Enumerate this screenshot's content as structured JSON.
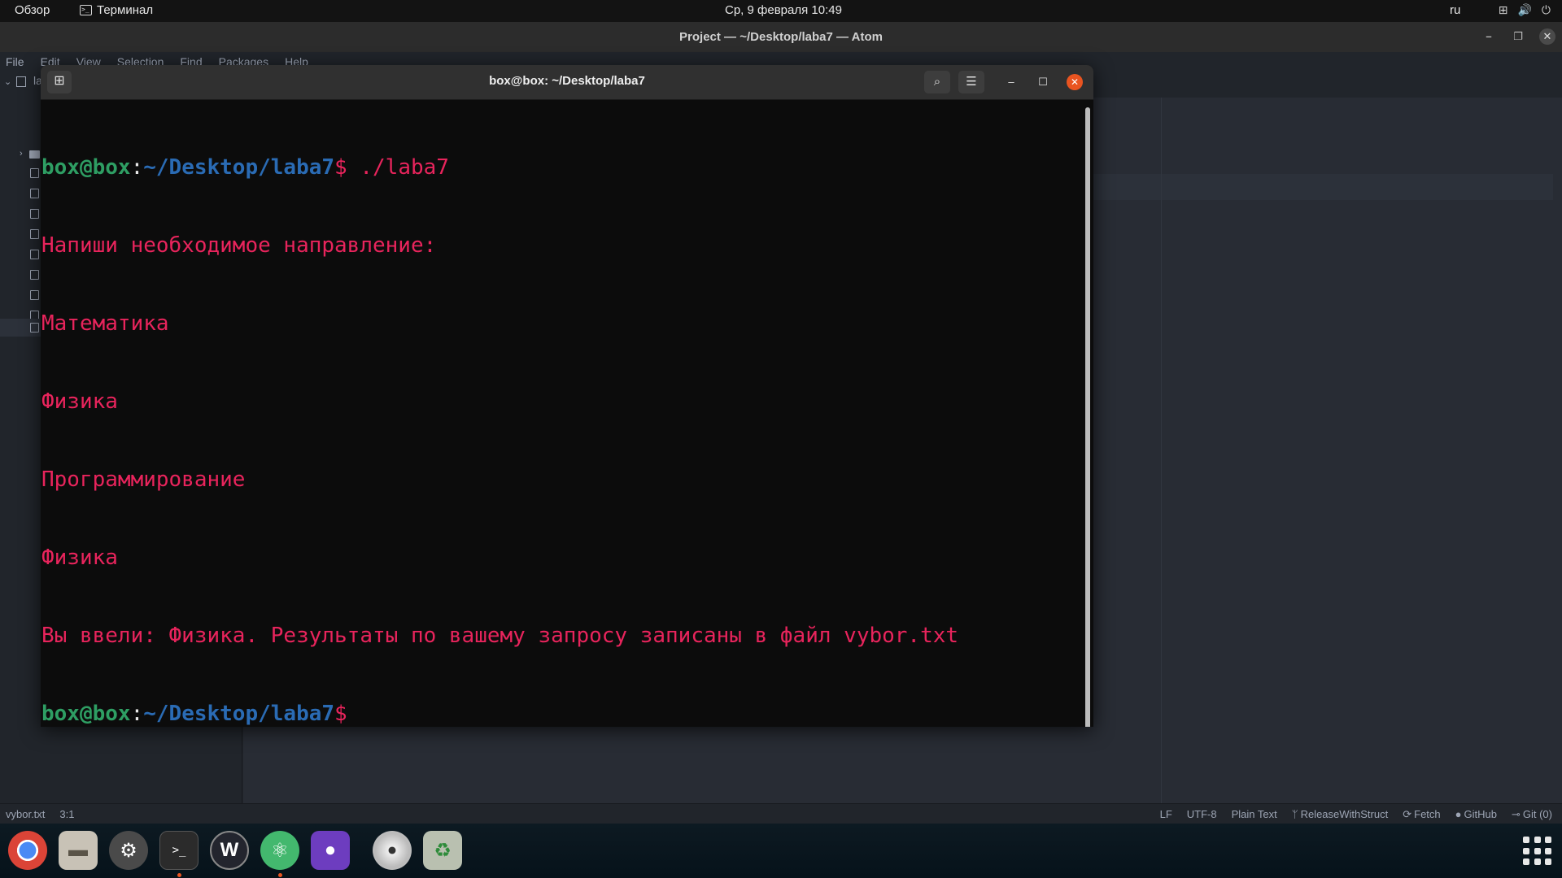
{
  "topbar": {
    "activities": "Обзор",
    "app_menu": "Терминал",
    "clock": "Ср, 9 февраля  10:49",
    "lang": "ru",
    "tray": {
      "network_icon": "⊞",
      "volume_icon": "🔊",
      "power_icon": "⏻"
    }
  },
  "atom": {
    "title": "Project — ~/Desktop/laba7 — Atom",
    "menu": [
      "File",
      "Edit",
      "View",
      "Selection",
      "Find",
      "Packages",
      "Help"
    ],
    "tree": {
      "root_label": "la"
    },
    "status": {
      "file": "vybor.txt",
      "cursor": "3:1",
      "line_ending": "LF",
      "encoding": "UTF-8",
      "grammar": "Plain Text",
      "branch": "ReleaseWithStruct",
      "fetch": "Fetch",
      "github": "GitHub",
      "git": "Git (0)"
    }
  },
  "terminal": {
    "title": "box@box: ~/Desktop/laba7",
    "prompt": {
      "user": "box@box",
      "sep": ":",
      "path": "~/Desktop/laba7",
      "dollar": "$"
    },
    "command": " ./laba7",
    "output": [
      "Напиши необходимое направление:",
      "Математика",
      "Физика",
      "Программирование",
      "Физика",
      "Вы ввели: Физика. Результаты по вашему запросу записаны в файл vybor.txt"
    ]
  },
  "dock": {
    "apps": [
      {
        "name": "chrome",
        "color": "#3c7bd9"
      },
      {
        "name": "files",
        "color": "#c8c2b6"
      },
      {
        "name": "settings",
        "color": "#5a5a5a"
      },
      {
        "name": "terminal",
        "color": "#2b2b2b"
      },
      {
        "name": "webstorm",
        "color": "#23252e"
      },
      {
        "name": "atom",
        "color": "#43b86e"
      },
      {
        "name": "github-desktop",
        "color": "#6d3dbf"
      },
      {
        "name": "disc",
        "color": "#d8d8d8"
      },
      {
        "name": "trash",
        "color": "#b9c0b0"
      }
    ]
  }
}
